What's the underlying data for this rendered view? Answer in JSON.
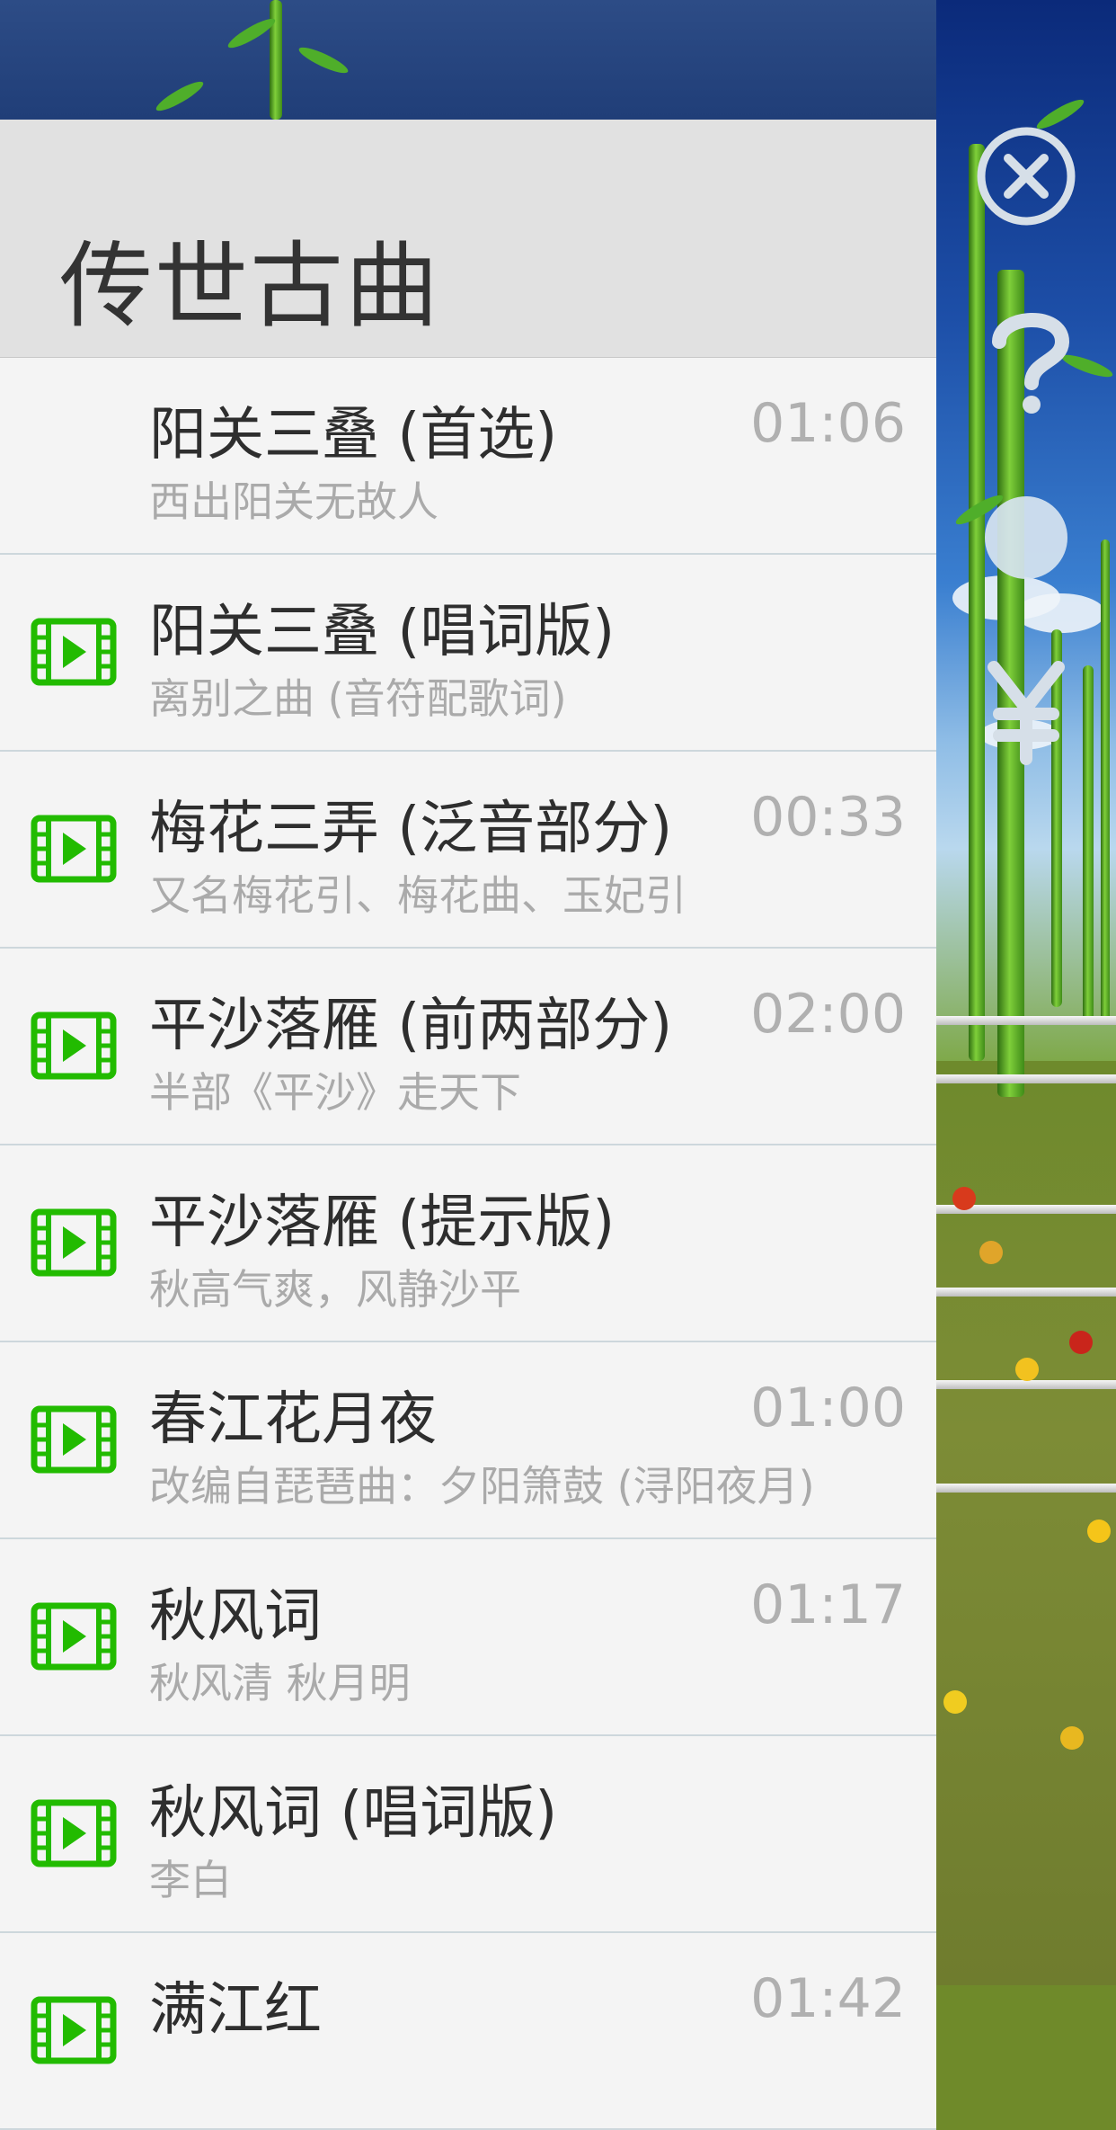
{
  "header": {
    "title": "传世古曲"
  },
  "items": [
    {
      "title": "阳关三叠 (首选)",
      "subtitle": "西出阳关无故人",
      "time": "01:06",
      "has_video": false
    },
    {
      "title": "阳关三叠 (唱词版)",
      "subtitle": "离别之曲 (音符配歌词)",
      "time": "",
      "has_video": true
    },
    {
      "title": "梅花三弄 (泛音部分)",
      "subtitle": "又名梅花引、梅花曲、玉妃引",
      "time": "00:33",
      "has_video": true
    },
    {
      "title": "平沙落雁 (前两部分)",
      "subtitle": "半部《平沙》走天下",
      "time": "02:00",
      "has_video": true
    },
    {
      "title": "平沙落雁 (提示版)",
      "subtitle": "秋高气爽，风静沙平",
      "time": "",
      "has_video": true
    },
    {
      "title": "春江花月夜",
      "subtitle": "改编自琵琶曲：夕阳箫鼓 (浔阳夜月)",
      "time": "01:00",
      "has_video": true
    },
    {
      "title": "秋风词",
      "subtitle": "秋风清 秋月明",
      "time": "01:17",
      "has_video": true
    },
    {
      "title": "秋风词 (唱词版)",
      "subtitle": "李白",
      "time": "",
      "has_video": true
    },
    {
      "title": "满江红",
      "subtitle": "",
      "time": "01:42",
      "has_video": true
    }
  ],
  "side_controls": [
    {
      "icon": "close-icon",
      "label": ""
    },
    {
      "icon": "help-icon",
      "label": "?"
    },
    {
      "icon": "dot-icon",
      "label": ""
    },
    {
      "icon": "yen-icon",
      "label": "¥"
    }
  ],
  "colors": {
    "video_icon": "#22bb00",
    "header_bg": "#e1e1e1",
    "row_bg": "#f4f4f4",
    "title_text": "#2e2e2e",
    "sub_text": "#aaaaaa",
    "top_strip": "#2d4c86"
  }
}
